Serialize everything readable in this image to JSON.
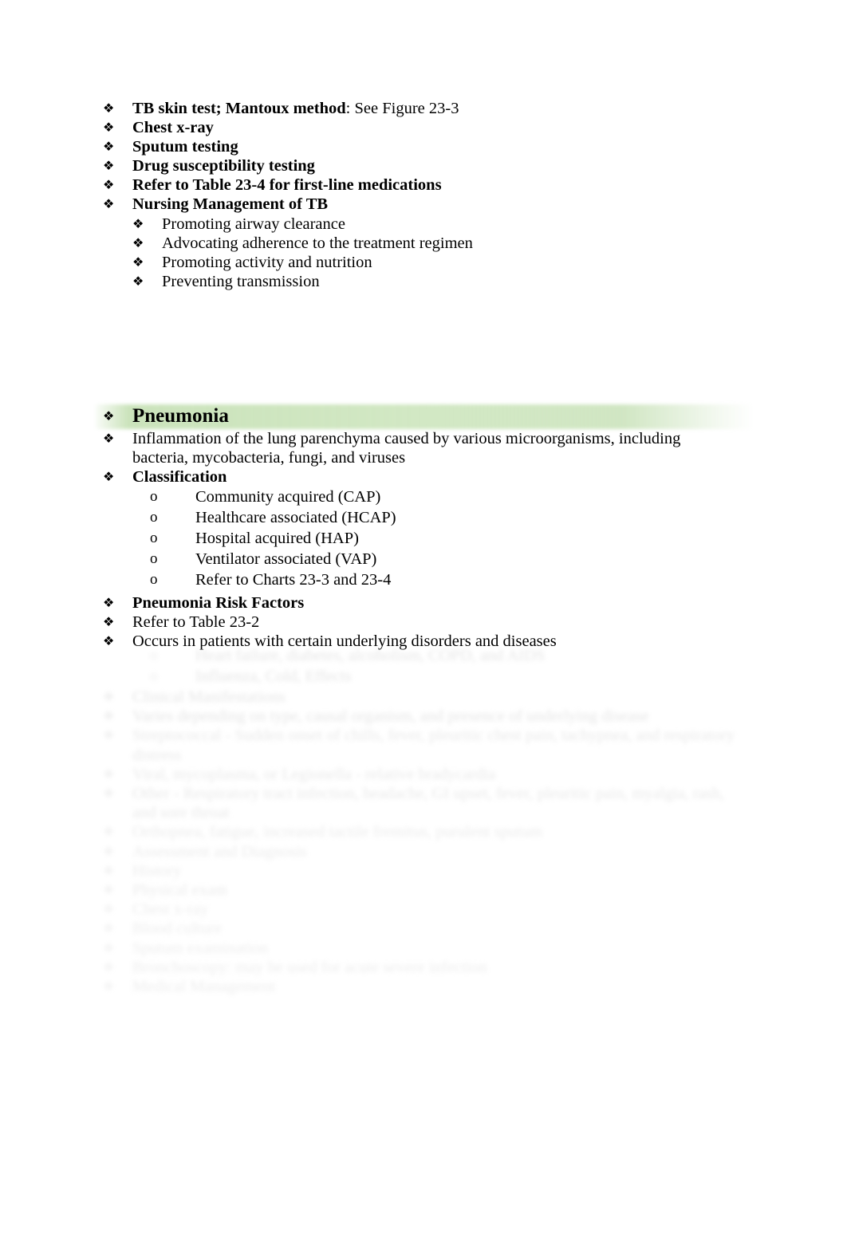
{
  "document": {
    "page_background": "#ffffff",
    "highlight_color": "#c5e0b4",
    "bullets": {
      "diamond": "❖",
      "circle": "o"
    }
  },
  "tb_section": {
    "items": [
      {
        "bold_part": "TB skin test; Mantoux method",
        "rest": ": See Figure 23-3",
        "level": 1
      },
      {
        "bold_part": "Chest x-ray",
        "rest": "",
        "level": 1
      },
      {
        "bold_part": "Sputum testing",
        "rest": "",
        "level": 1
      },
      {
        "bold_part": "Drug susceptibility testing",
        "rest": "",
        "level": 1
      },
      {
        "bold_part": "Refer to Table 23-4 for first-line medications",
        "rest": "",
        "level": 1
      },
      {
        "bold_part": "Nursing Management of TB",
        "rest": "",
        "level": 1
      },
      {
        "bold_part": "",
        "rest": "Promoting airway clearance",
        "level": 2
      },
      {
        "bold_part": "",
        "rest": "Advocating adherence to the treatment regimen",
        "level": 2
      },
      {
        "bold_part": "",
        "rest": "Promoting activity and nutrition",
        "level": 2
      },
      {
        "bold_part": "",
        "rest": "Preventing transmission",
        "level": 2
      }
    ]
  },
  "pneumonia_section": {
    "heading": "Pneumonia",
    "definition_line1": "Inflammation of the lung parenchyma caused by various microorganisms, including",
    "definition_line2": "bacteria, mycobacteria, fungi, and viruses",
    "classification_label": "Classification",
    "classification_items": [
      "Community acquired (CAP)",
      "Healthcare associated (HCAP)",
      "Hospital acquired (HAP)",
      "Ventilator associated (VAP)",
      "Refer to Charts 23-3 and 23-4"
    ],
    "risk_factors_label": "Pneumonia Risk Factors",
    "refer_table": "Refer to Table 23-2",
    "occurs_line": "Occurs in patients with certain underlying disorders and diseases"
  },
  "faded_section": {
    "note": "Content below is heavily blurred / faded in the source image; text is approximate.",
    "items": [
      {
        "text": "Heart failure, diabetes, alcoholism, COPD, and AIDS",
        "level": "2o"
      },
      {
        "text": "Influenza, Cold, Effects",
        "level": "2o"
      },
      {
        "text": "Clinical Manifestations",
        "level": "1"
      },
      {
        "text": "Varies depending on type, causal organism, and presence of underlying disease",
        "level": "1"
      },
      {
        "text": "Streptococcal - Sudden onset of chills, fever, pleuritic chest pain, tachypnea, and respiratory",
        "level": "1"
      },
      {
        "text": "distress",
        "level": "1-cont"
      },
      {
        "text": "Viral, mycoplasma, or Legionella - relative bradycardia",
        "level": "1"
      },
      {
        "text": "Other - Respiratory tract infection, headache, GI upset, fever, pleuritic pain, myalgia, rash,",
        "level": "1"
      },
      {
        "text": "and sore throat",
        "level": "1-cont"
      },
      {
        "text": "Orthopnea, fatigue, increased tactile fremitus, purulent sputum",
        "level": "1"
      },
      {
        "text": "Assessment and Diagnosis",
        "level": "1"
      },
      {
        "text": "History",
        "level": "1"
      },
      {
        "text": "Physical exam",
        "level": "1"
      },
      {
        "text": "Chest x-ray",
        "level": "1"
      },
      {
        "text": "Blood culture",
        "level": "1"
      },
      {
        "text": "Sputum examination",
        "level": "1"
      },
      {
        "text": "Bronchoscopy: may be used for acute severe infection",
        "level": "1"
      },
      {
        "text": "Medical Management",
        "level": "1"
      }
    ]
  }
}
